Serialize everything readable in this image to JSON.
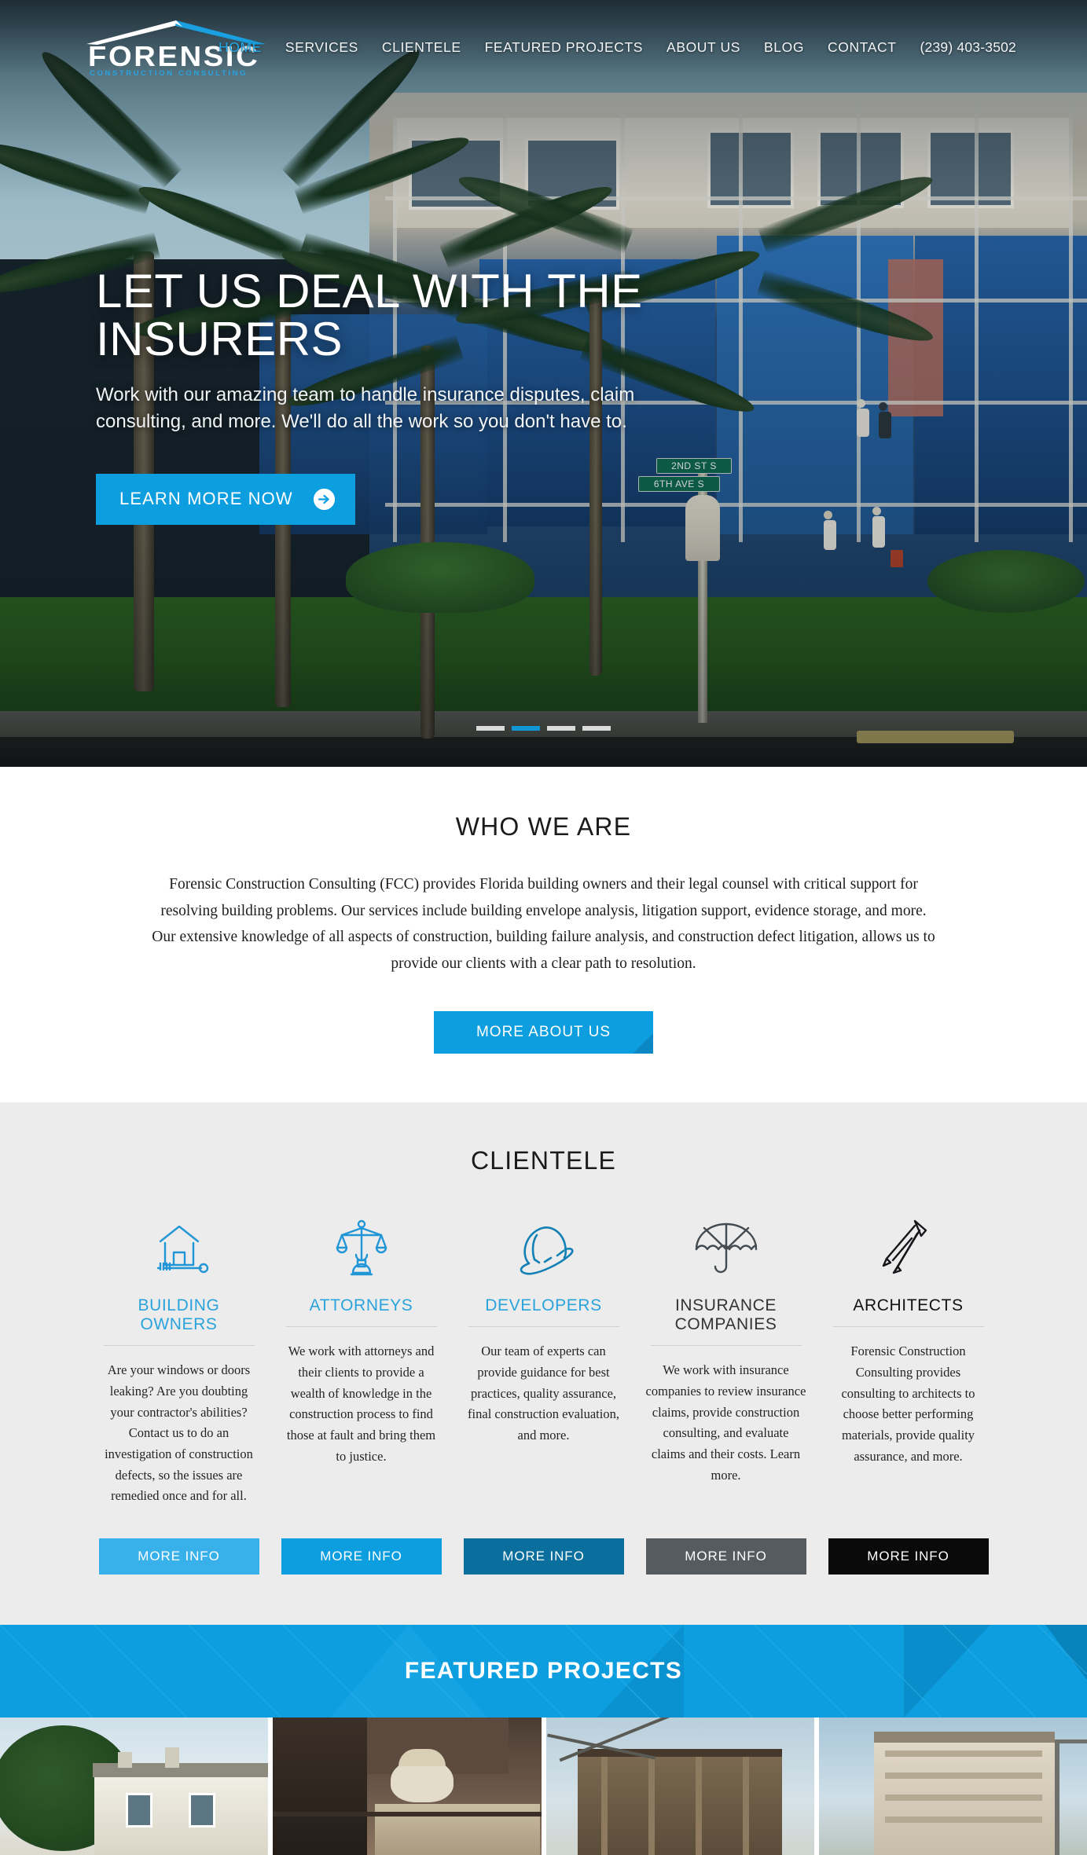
{
  "brand": {
    "name": "FORENSIC",
    "tagline": "CONSTRUCTION CONSULTING",
    "accent": "#0d9ee0",
    "logo_icon": "roof-chevron-icon"
  },
  "nav": {
    "items": [
      {
        "label": "HOME",
        "active": true
      },
      {
        "label": "SERVICES",
        "active": false
      },
      {
        "label": "CLIENTELE",
        "active": false
      },
      {
        "label": "FEATURED PROJECTS",
        "active": false
      },
      {
        "label": "ABOUT US",
        "active": false
      },
      {
        "label": "BLOG",
        "active": false
      },
      {
        "label": "CONTACT",
        "active": false
      }
    ],
    "phone": "(239) 403-3502"
  },
  "hero": {
    "title": "LET US DEAL WITH THE INSURERS",
    "subtitle": "Work with our amazing team to handle insurance disputes, claim consulting, and more. We'll do all the work so you don't have to.",
    "cta_label": "LEARN MORE NOW",
    "cta_icon": "arrow-right-circle-icon",
    "slider": {
      "total": 4,
      "active_index": 1
    }
  },
  "who_we_are": {
    "title": "WHO WE ARE",
    "body": "Forensic Construction Consulting (FCC) provides Florida building owners and their legal counsel with critical support for resolving building problems. Our services include building envelope analysis, litigation support, evidence storage, and more. Our extensive knowledge of all aspects of construction, building failure analysis, and construction defect litigation, allows us to provide our clients with a clear path to resolution.",
    "cta_label": "MORE ABOUT US"
  },
  "clientele": {
    "title": "CLIENTELE",
    "button_label": "MORE INFO",
    "cards": [
      {
        "icon": "house-key-icon",
        "title": "BUILDING OWNERS",
        "title_color": "#2aa3dd",
        "text": "Are your windows or doors leaking? Are you doubting your contractor's abilities? Contact us to do an investigation of construction defects, so the issues are remedied once and for all.",
        "button_color": "#38b0ea"
      },
      {
        "icon": "scales-of-justice-icon",
        "title": "ATTORNEYS",
        "title_color": "#2aa3dd",
        "text": "We work with attorneys and their clients to provide a wealth of knowledge in the construction process to find those at fault and bring them to justice.",
        "button_color": "#0d9ee0"
      },
      {
        "icon": "hard-hat-icon",
        "title": "DEVELOPERS",
        "title_color": "#2aa3dd",
        "text": "Our team of experts can provide guidance for best practices, quality assurance, final construction evaluation, and more.",
        "button_color": "#0b6f9e"
      },
      {
        "icon": "umbrella-icon",
        "title": "INSURANCE COMPANIES",
        "title_color": "#3a3a3a",
        "text": "We work with insurance companies to review insurance claims, provide construction consulting, and evaluate claims and their costs. Learn more.",
        "button_color": "#555b5e"
      },
      {
        "icon": "compass-divider-icon",
        "title": "ARCHITECTS",
        "title_color": "#111111",
        "text": "Forensic Construction Consulting provides consulting to architects to choose better performing materials, provide quality assurance, and more.",
        "button_color": "#0a0a0a"
      }
    ]
  },
  "featured_projects": {
    "title": "FEATURED PROJECTS",
    "banner_color": "#0d9ee0",
    "thumbnails": [
      {
        "name": "coastal-home-project"
      },
      {
        "name": "masonry-work-project"
      },
      {
        "name": "framing-project"
      },
      {
        "name": "condo-tower-project"
      }
    ]
  }
}
